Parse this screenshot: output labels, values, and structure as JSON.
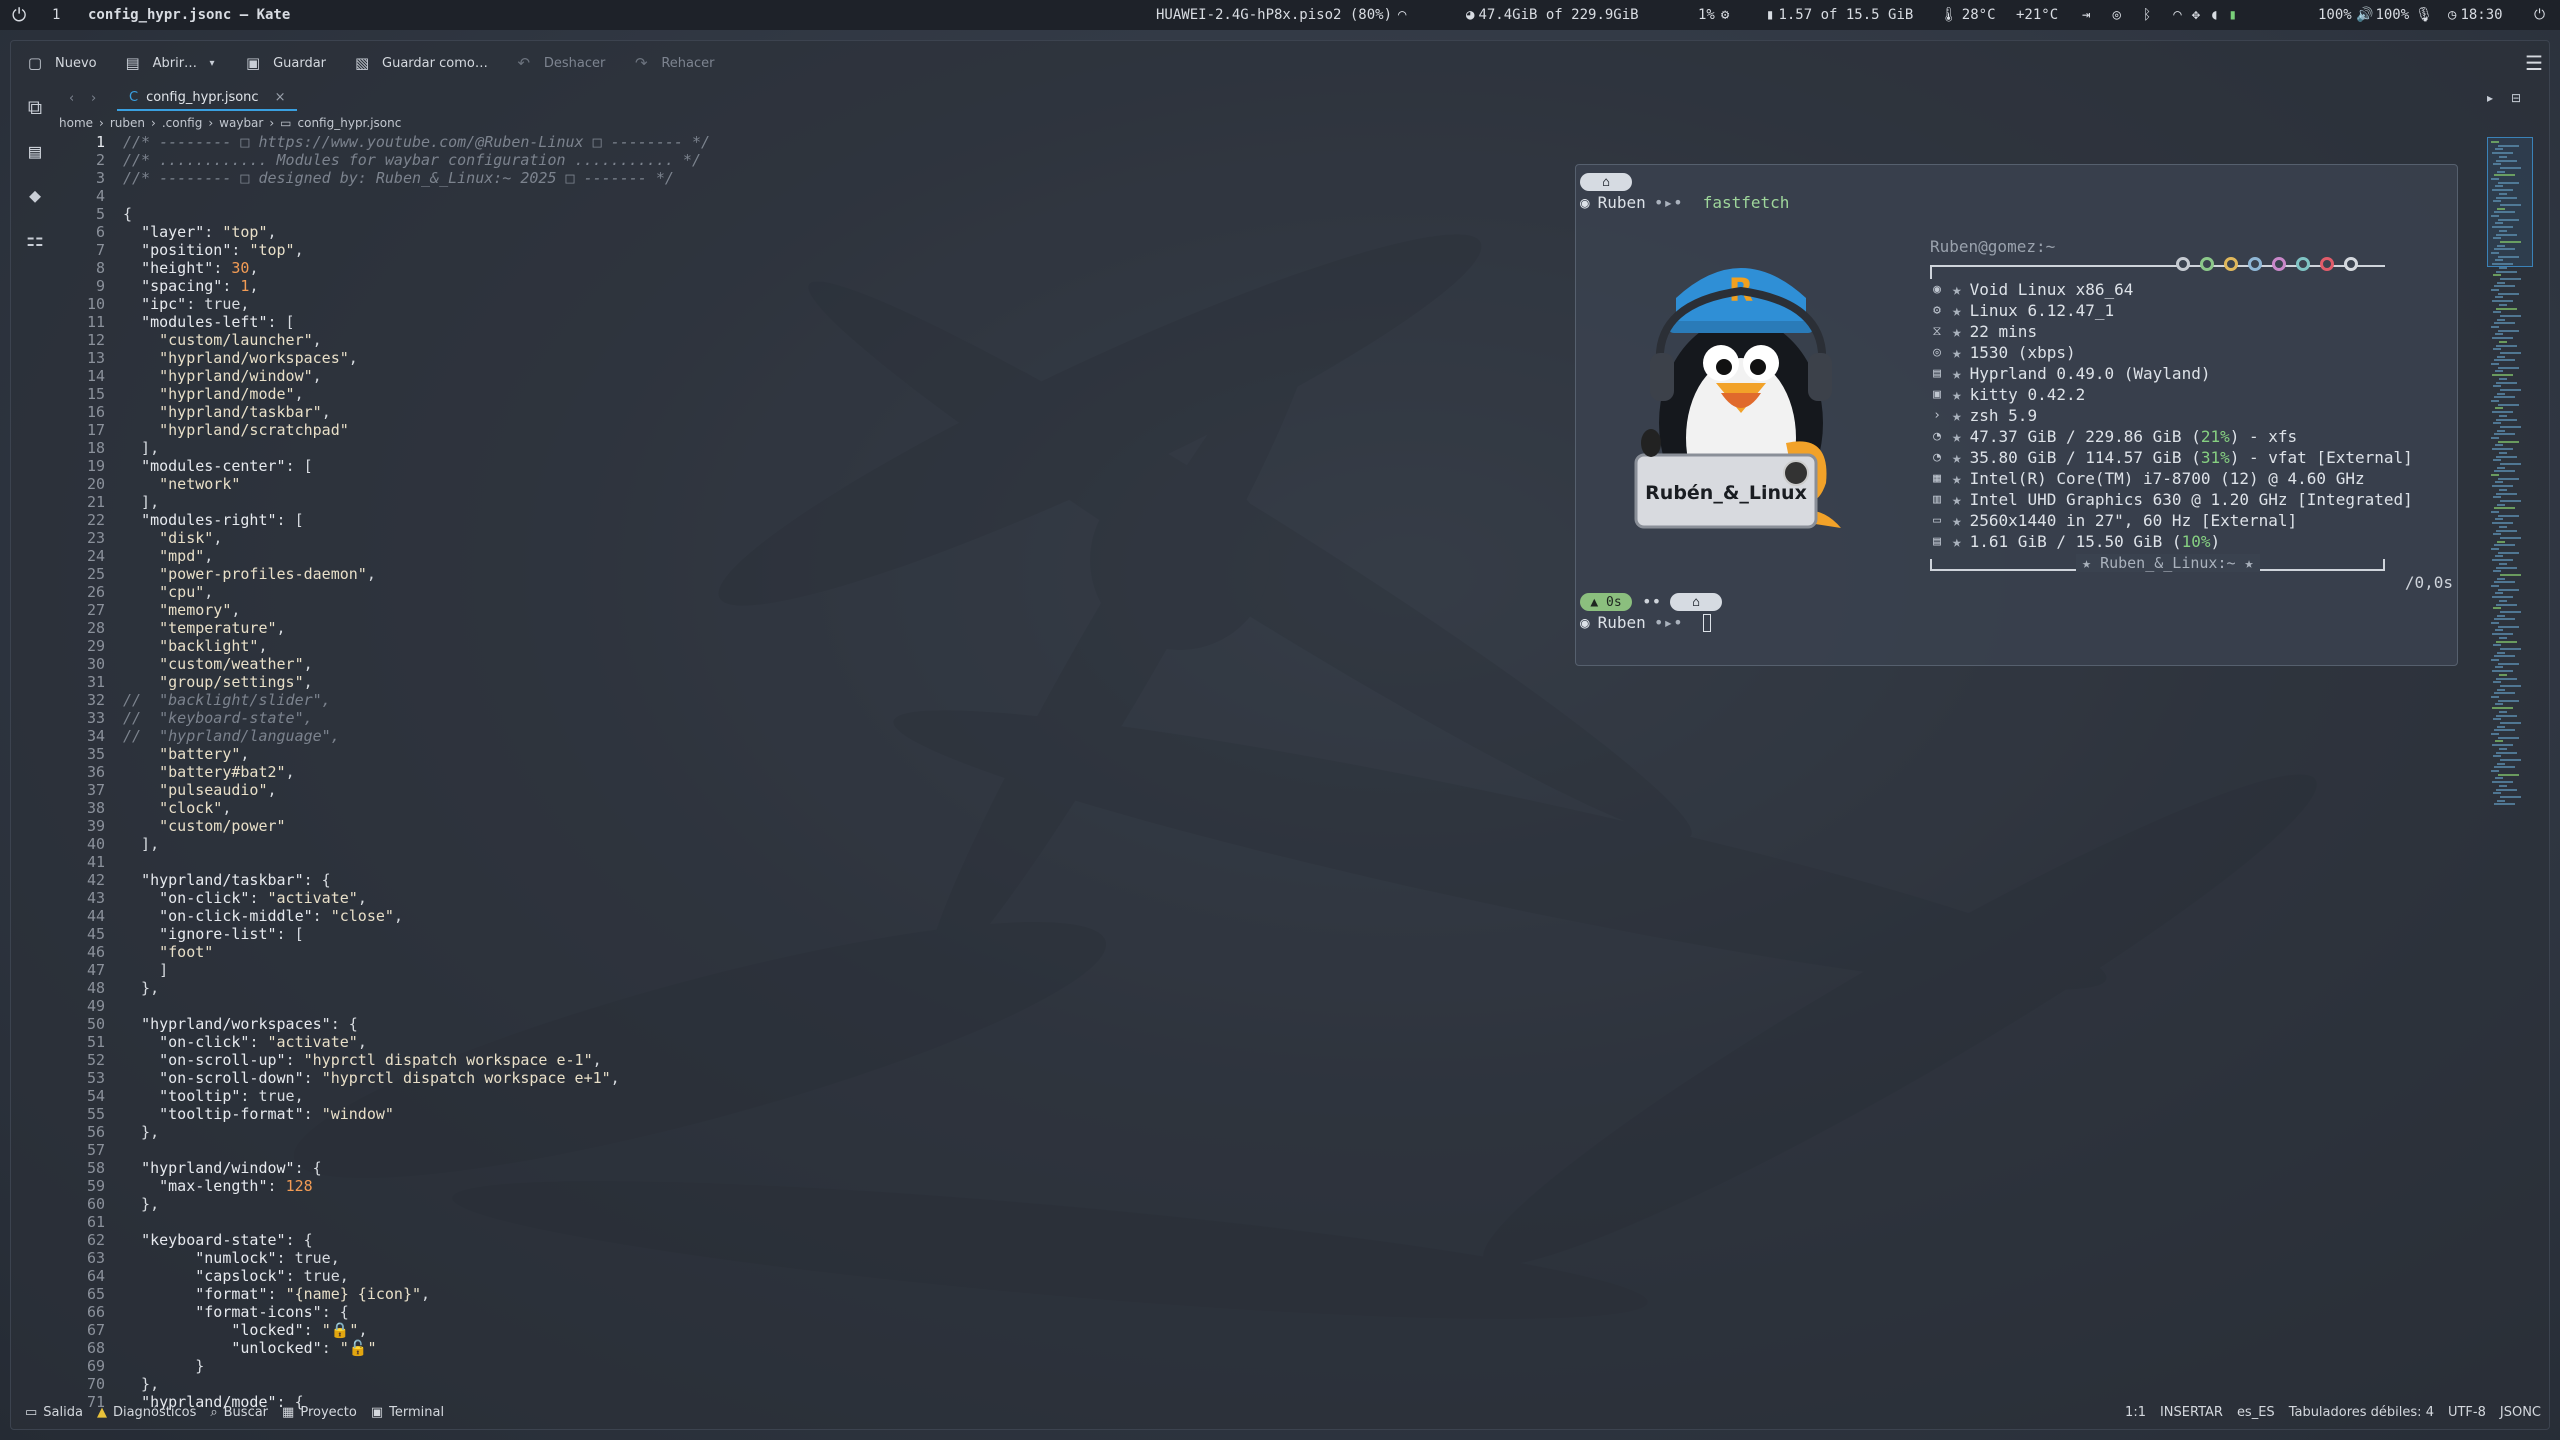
{
  "topbar": {
    "workspace": "1",
    "window_title": "config_hypr.jsonc  — Kate",
    "network": "HUAWEI-2.4G-hP8x.piso2 (80%)",
    "disk": "47.4GiB of 229.9GiB",
    "disk_unit": "GiB",
    "cpu": "1%",
    "memory": "1.57 of 15.5 GiB",
    "temperature": "28°C",
    "weather": "+21°C",
    "backlight": "100%",
    "volume": "100%",
    "clock": "18:30"
  },
  "toolbar": {
    "new_label": "Nuevo",
    "open_label": "Abrir…",
    "save_label": "Guardar",
    "save_as_label": "Guardar como…",
    "undo_label": "Deshacer",
    "redo_label": "Rehacer"
  },
  "tab": {
    "label": "config_hypr.jsonc"
  },
  "breadcrumb": [
    "home",
    "ruben",
    ".config",
    "waybar",
    "config_hypr.jsonc"
  ],
  "code_lines": [
    [
      [
        "c",
        "//* -------- □ https://www.youtube.com/@Ruben-Linux □ -------- */"
      ]
    ],
    [
      [
        "c",
        "//* ............ Modules for waybar configuration ........... */"
      ]
    ],
    [
      [
        "c",
        "//* -------- □ designed by: Ruben_&_Linux:~ 2025 □ ------- */"
      ]
    ],
    [],
    [
      [
        "p",
        "{"
      ]
    ],
    [
      [
        "p",
        "  "
      ],
      [
        "k",
        "\"layer\""
      ],
      [
        "p",
        ": "
      ],
      [
        "s",
        "\"top\""
      ],
      [
        "p",
        ","
      ]
    ],
    [
      [
        "p",
        "  "
      ],
      [
        "k",
        "\"position\""
      ],
      [
        "p",
        ": "
      ],
      [
        "s",
        "\"top\""
      ],
      [
        "p",
        ","
      ]
    ],
    [
      [
        "p",
        "  "
      ],
      [
        "k",
        "\"height\""
      ],
      [
        "p",
        ": "
      ],
      [
        "n",
        "30"
      ],
      [
        "p",
        ","
      ]
    ],
    [
      [
        "p",
        "  "
      ],
      [
        "k",
        "\"spacing\""
      ],
      [
        "p",
        ": "
      ],
      [
        "n",
        "1"
      ],
      [
        "p",
        ","
      ]
    ],
    [
      [
        "p",
        "  "
      ],
      [
        "k",
        "\"ipc\""
      ],
      [
        "p",
        ": true,"
      ]
    ],
    [
      [
        "p",
        "  "
      ],
      [
        "k",
        "\"modules-left\""
      ],
      [
        "p",
        ": ["
      ]
    ],
    [
      [
        "p",
        "    "
      ],
      [
        "s",
        "\"custom/launcher\""
      ],
      [
        "p",
        ","
      ]
    ],
    [
      [
        "p",
        "    "
      ],
      [
        "s",
        "\"hyprland/workspaces\""
      ],
      [
        "p",
        ","
      ]
    ],
    [
      [
        "p",
        "    "
      ],
      [
        "s",
        "\"hyprland/window\""
      ],
      [
        "p",
        ","
      ]
    ],
    [
      [
        "p",
        "    "
      ],
      [
        "s",
        "\"hyprland/mode\""
      ],
      [
        "p",
        ","
      ]
    ],
    [
      [
        "p",
        "    "
      ],
      [
        "s",
        "\"hyprland/taskbar\""
      ],
      [
        "p",
        ","
      ]
    ],
    [
      [
        "p",
        "    "
      ],
      [
        "s",
        "\"hyprland/scratchpad\""
      ]
    ],
    [
      [
        "p",
        "  ],"
      ]
    ],
    [
      [
        "p",
        "  "
      ],
      [
        "k",
        "\"modules-center\""
      ],
      [
        "p",
        ": ["
      ]
    ],
    [
      [
        "p",
        "    "
      ],
      [
        "s",
        "\"network\""
      ]
    ],
    [
      [
        "p",
        "  ],"
      ]
    ],
    [
      [
        "p",
        "  "
      ],
      [
        "k",
        "\"modules-right\""
      ],
      [
        "p",
        ": ["
      ]
    ],
    [
      [
        "p",
        "    "
      ],
      [
        "s",
        "\"disk\""
      ],
      [
        "p",
        ","
      ]
    ],
    [
      [
        "p",
        "    "
      ],
      [
        "s",
        "\"mpd\""
      ],
      [
        "p",
        ","
      ]
    ],
    [
      [
        "p",
        "    "
      ],
      [
        "s",
        "\"power-profiles-daemon\""
      ],
      [
        "p",
        ","
      ]
    ],
    [
      [
        "p",
        "    "
      ],
      [
        "s",
        "\"cpu\""
      ],
      [
        "p",
        ","
      ]
    ],
    [
      [
        "p",
        "    "
      ],
      [
        "s",
        "\"memory\""
      ],
      [
        "p",
        ","
      ]
    ],
    [
      [
        "p",
        "    "
      ],
      [
        "s",
        "\"temperature\""
      ],
      [
        "p",
        ","
      ]
    ],
    [
      [
        "p",
        "    "
      ],
      [
        "s",
        "\"backlight\""
      ],
      [
        "p",
        ","
      ]
    ],
    [
      [
        "p",
        "    "
      ],
      [
        "s",
        "\"custom/weather\""
      ],
      [
        "p",
        ","
      ]
    ],
    [
      [
        "p",
        "    "
      ],
      [
        "s",
        "\"group/settings\""
      ],
      [
        "p",
        ","
      ]
    ],
    [
      [
        "c",
        "//  \"backlight/slider\","
      ]
    ],
    [
      [
        "c",
        "//  \"keyboard-state\","
      ]
    ],
    [
      [
        "c",
        "//  \"hyprland/language\","
      ]
    ],
    [
      [
        "p",
        "    "
      ],
      [
        "s",
        "\"battery\""
      ],
      [
        "p",
        ","
      ]
    ],
    [
      [
        "p",
        "    "
      ],
      [
        "s",
        "\"battery#bat2\""
      ],
      [
        "p",
        ","
      ]
    ],
    [
      [
        "p",
        "    "
      ],
      [
        "s",
        "\"pulseaudio\""
      ],
      [
        "p",
        ","
      ]
    ],
    [
      [
        "p",
        "    "
      ],
      [
        "s",
        "\"clock\""
      ],
      [
        "p",
        ","
      ]
    ],
    [
      [
        "p",
        "    "
      ],
      [
        "s",
        "\"custom/power\""
      ]
    ],
    [
      [
        "p",
        "  ],"
      ]
    ],
    [],
    [
      [
        "p",
        "  "
      ],
      [
        "k",
        "\"hyprland/taskbar\""
      ],
      [
        "p",
        ": {"
      ]
    ],
    [
      [
        "p",
        "    "
      ],
      [
        "k",
        "\"on-click\""
      ],
      [
        "p",
        ": "
      ],
      [
        "s",
        "\"activate\""
      ],
      [
        "p",
        ","
      ]
    ],
    [
      [
        "p",
        "    "
      ],
      [
        "k",
        "\"on-click-middle\""
      ],
      [
        "p",
        ": "
      ],
      [
        "s",
        "\"close\""
      ],
      [
        "p",
        ","
      ]
    ],
    [
      [
        "p",
        "    "
      ],
      [
        "k",
        "\"ignore-list\""
      ],
      [
        "p",
        ": ["
      ]
    ],
    [
      [
        "p",
        "    "
      ],
      [
        "s",
        "\"foot\""
      ]
    ],
    [
      [
        "p",
        "    ]"
      ]
    ],
    [
      [
        "p",
        "  },"
      ]
    ],
    [],
    [
      [
        "p",
        "  "
      ],
      [
        "k",
        "\"hyprland/workspaces\""
      ],
      [
        "p",
        ": {"
      ]
    ],
    [
      [
        "p",
        "    "
      ],
      [
        "k",
        "\"on-click\""
      ],
      [
        "p",
        ": "
      ],
      [
        "s",
        "\"activate\""
      ],
      [
        "p",
        ","
      ]
    ],
    [
      [
        "p",
        "    "
      ],
      [
        "k",
        "\"on-scroll-up\""
      ],
      [
        "p",
        ": "
      ],
      [
        "s",
        "\"hyprctl dispatch workspace e-1\""
      ],
      [
        "p",
        ","
      ]
    ],
    [
      [
        "p",
        "    "
      ],
      [
        "k",
        "\"on-scroll-down\""
      ],
      [
        "p",
        ": "
      ],
      [
        "s",
        "\"hyprctl dispatch workspace e+1\""
      ],
      [
        "p",
        ","
      ]
    ],
    [
      [
        "p",
        "    "
      ],
      [
        "k",
        "\"tooltip\""
      ],
      [
        "p",
        ": true,"
      ]
    ],
    [
      [
        "p",
        "    "
      ],
      [
        "k",
        "\"tooltip-format\""
      ],
      [
        "p",
        ": "
      ],
      [
        "s",
        "\"window\""
      ]
    ],
    [
      [
        "p",
        "  },"
      ]
    ],
    [],
    [
      [
        "p",
        "  "
      ],
      [
        "k",
        "\"hyprland/window\""
      ],
      [
        "p",
        ": {"
      ]
    ],
    [
      [
        "p",
        "    "
      ],
      [
        "k",
        "\"max-length\""
      ],
      [
        "p",
        ": "
      ],
      [
        "n",
        "128"
      ]
    ],
    [
      [
        "p",
        "  },"
      ]
    ],
    [],
    [
      [
        "p",
        "  "
      ],
      [
        "k",
        "\"keyboard-state\""
      ],
      [
        "p",
        ": {"
      ]
    ],
    [
      [
        "p",
        "        "
      ],
      [
        "k",
        "\"numlock\""
      ],
      [
        "p",
        ": true,"
      ]
    ],
    [
      [
        "p",
        "        "
      ],
      [
        "k",
        "\"capslock\""
      ],
      [
        "p",
        ": true,"
      ]
    ],
    [
      [
        "p",
        "        "
      ],
      [
        "k",
        "\"format\""
      ],
      [
        "p",
        ": "
      ],
      [
        "s",
        "\"{name} {icon}\""
      ],
      [
        "p",
        ","
      ]
    ],
    [
      [
        "p",
        "        "
      ],
      [
        "k",
        "\"format-icons\""
      ],
      [
        "p",
        ": {"
      ]
    ],
    [
      [
        "p",
        "            "
      ],
      [
        "k",
        "\"locked\""
      ],
      [
        "p",
        ": "
      ],
      [
        "s",
        "\"🔒\""
      ],
      [
        "p",
        ","
      ]
    ],
    [
      [
        "p",
        "            "
      ],
      [
        "k",
        "\"unlocked\""
      ],
      [
        "p",
        ": "
      ],
      [
        "s",
        "\"🔓\""
      ]
    ],
    [
      [
        "p",
        "        }"
      ]
    ],
    [
      [
        "p",
        "  },"
      ]
    ],
    [
      [
        "p",
        "  "
      ],
      [
        "k",
        "\"hyprland/mode\""
      ],
      [
        "p",
        ": {"
      ]
    ]
  ],
  "terminal": {
    "prompt_user": "Ruben",
    "command": "fastfetch",
    "header": "Ruben@gomez:~",
    "logo_text": "Rubén_&_Linux",
    "footer": "Ruben_&_Linux:~",
    "duration_pill": "0s",
    "elapsed": "/0,0s",
    "info_lines": [
      {
        "icon": "void-icon",
        "glyph": "◉",
        "text": "Void Linux x86_64"
      },
      {
        "icon": "kernel-icon",
        "glyph": "⚙",
        "text": "Linux 6.12.47_1"
      },
      {
        "icon": "uptime-icon",
        "glyph": "⧖",
        "text": "22 mins"
      },
      {
        "icon": "packages-icon",
        "glyph": "◎",
        "text": "1530 (xbps)"
      },
      {
        "icon": "wm-icon",
        "glyph": "▤",
        "text": "Hyprland 0.49.0 (Wayland)"
      },
      {
        "icon": "terminal-icon",
        "glyph": "▣",
        "text": "kitty 0.42.2"
      },
      {
        "icon": "shell-icon",
        "glyph": "›",
        "text": "zsh 5.9"
      },
      {
        "icon": "disk-icon",
        "glyph": "◔",
        "text_before": "47.37 GiB / 229.86 GiB (",
        "highlight": "21%",
        "text_after": ") - xfs"
      },
      {
        "icon": "disk-external-icon",
        "glyph": "◔",
        "text_before": "35.80 GiB / 114.57 GiB (",
        "highlight": "31%",
        "text_after": ") - vfat [External]"
      },
      {
        "icon": "cpu-icon",
        "glyph": "▦",
        "text": "Intel(R) Core(TM) i7-8700 (12) @ 4.60 GHz"
      },
      {
        "icon": "gpu-icon",
        "glyph": "▥",
        "text": "Intel UHD Graphics 630 @ 1.20 GHz [Integrated]"
      },
      {
        "icon": "display-icon",
        "glyph": "▭",
        "text": "2560x1440 in 27\", 60 Hz [External]"
      },
      {
        "icon": "memory-icon",
        "glyph": "▤",
        "text_before": "1.61 GiB / 15.50 GiB (",
        "highlight": "10%",
        "text_after": ")"
      }
    ],
    "colors": [
      "#c6cbd2",
      "#8cc88a",
      "#e0b85c",
      "#8fb7d6",
      "#c987c9",
      "#7fc4c4",
      "#e05c6a",
      "#d4d8de"
    ]
  },
  "statusbar": {
    "output": "Salida",
    "diagnostics": "Diagnósticos",
    "search": "Buscar",
    "project": "Proyecto",
    "terminal": "Terminal",
    "position": "1:1",
    "mode": "INSERTAR",
    "language": "es_ES",
    "tabs": "Tabuladores débiles: 4",
    "encoding": "UTF-8",
    "syntax": "JSONC"
  },
  "colors": {
    "accent": "#3aa0e0",
    "string": "#e8dfc8",
    "number": "#f39c55",
    "comment": "#7c838e",
    "highlight_green": "#86d081"
  }
}
